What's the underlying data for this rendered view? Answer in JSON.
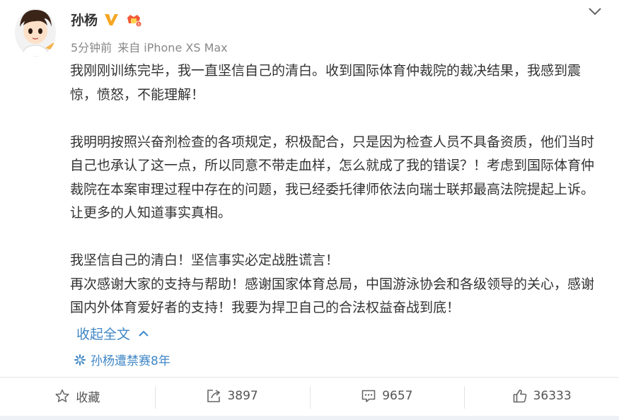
{
  "post": {
    "author": "孙杨",
    "time": "5分钟前",
    "source": "来自 iPhone XS Max",
    "paragraphs": [
      "我刚刚训练完毕，我一直坚信自己的清白。收到国际体育仲裁院的裁决结果，我感到震惊，愤怒，不能理解！",
      "",
      "我明明按照兴奋剂检查的各项规定，积极配合，只是因为检查人员不具备资质，他们当时自己也承认了这一点，所以同意不带走血样，怎么就成了我的错误？！考虑到国际体育仲裁院在本案审理过程中存在的问题，我已经委托律师依法向瑞士联邦最高法院提起上诉。让更多的人知道事实真相。",
      "",
      "我坚信自己的清白！坚信事实必定战胜谎言！",
      "再次感谢大家的支持与帮助！感谢国家体育总局，中国游泳协会和各级领导的关心，感谢国内外体育爱好者的支持！我要为捍卫自己的合法权益奋战到底！"
    ],
    "collapse_label": "收起全文",
    "topic": "孙杨遭禁赛8年"
  },
  "actions": {
    "favorite_label": "收藏",
    "repost_count": "3897",
    "comment_count": "9657",
    "like_count": "36333"
  },
  "colors": {
    "link": "#3f86c5",
    "verified": "#f6a623",
    "text": "#333333",
    "meta": "#888888"
  },
  "icons": {
    "avatar": "avatar",
    "verified": "verified-v-icon",
    "badge": "member-badge-icon",
    "menu": "chevron-down-icon",
    "collapse": "chevron-up-icon",
    "topic": "topic-snowflake-icon",
    "favorite": "star-icon",
    "repost": "share-icon",
    "comment": "comment-icon",
    "like": "thumbs-up-icon"
  }
}
